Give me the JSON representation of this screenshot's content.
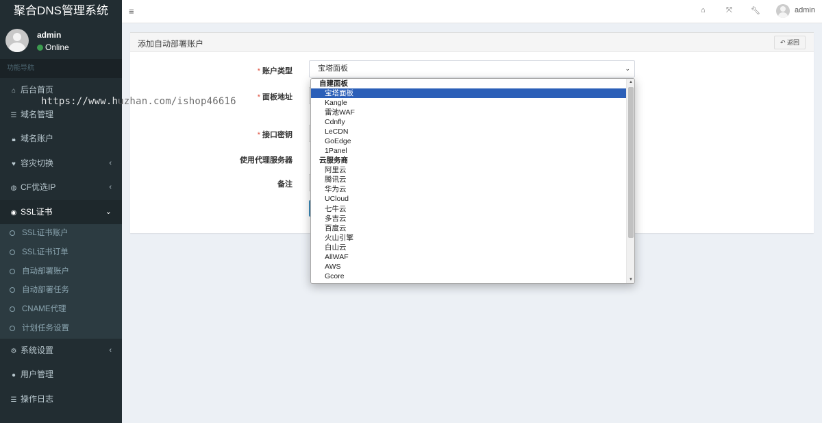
{
  "app": {
    "title": "聚合DNS管理系统"
  },
  "user": {
    "name": "admin",
    "status": "Online"
  },
  "sidebar": {
    "header": "功能导航",
    "items": [
      {
        "label": "后台首页",
        "icon": "home-icon",
        "glyph": "⌂"
      },
      {
        "label": "域名管理",
        "icon": "list-icon",
        "glyph": "☰"
      },
      {
        "label": "域名账户",
        "icon": "lock-icon",
        "glyph": "🔒︎"
      },
      {
        "label": "容灾切换",
        "icon": "heartbeat-icon",
        "glyph": "♥"
      },
      {
        "label": "CF优选IP",
        "icon": "globe-icon",
        "glyph": "◍"
      },
      {
        "label": "SSL证书",
        "icon": "certificate-icon",
        "glyph": "◉"
      },
      {
        "label": "系统设置",
        "icon": "gears-icon",
        "glyph": "⚙"
      },
      {
        "label": "用户管理",
        "icon": "user-icon",
        "glyph": "●"
      },
      {
        "label": "操作日志",
        "icon": "list-icon",
        "glyph": "☰"
      }
    ],
    "ssl_submenu": [
      "SSL证书账户",
      "SSL证书订单",
      "自动部署账户",
      "自动部署任务",
      "CNAME代理",
      "计划任务设置"
    ]
  },
  "topbar": {
    "user": "admin"
  },
  "panel": {
    "title": "添加自动部署账户",
    "back_label": "返回"
  },
  "form": {
    "account_type_label": "账户类型",
    "panel_address_label": "面板地址",
    "api_key_label": "接口密钥",
    "proxy_label": "使用代理服务器",
    "remark_label": "备注",
    "account_type_value": "宝塔面板"
  },
  "dropdown": {
    "group1": "自建面板",
    "group1_options": [
      "宝塔面板",
      "Kangle",
      "雷池WAF",
      "Cdnfly",
      "LeCDN",
      "GoEdge",
      "1Panel"
    ],
    "group2": "云服务商",
    "group2_options": [
      "阿里云",
      "腾讯云",
      "华为云",
      "UCloud",
      "七牛云",
      "多吉云",
      "百度云",
      "火山引擎",
      "白山云",
      "AllWAF",
      "AWS",
      "Gcore"
    ],
    "selected": "宝塔面板"
  },
  "watermark": "https://www.huzhan.com/ishop46616"
}
